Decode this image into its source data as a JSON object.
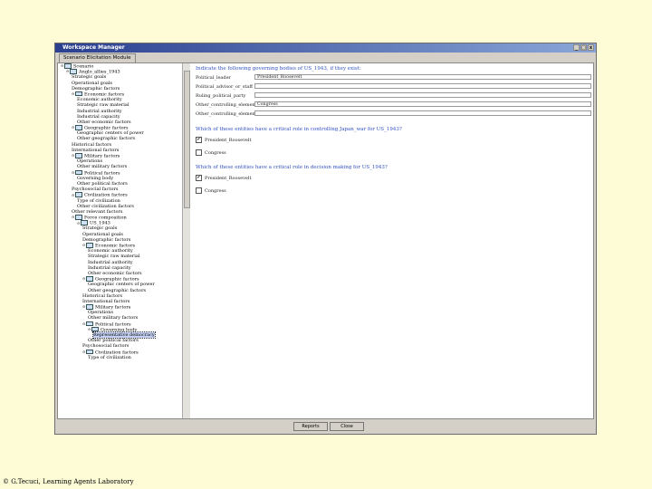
{
  "window": {
    "title": "Workspace Manager",
    "controls": [
      "_",
      "□",
      "x"
    ]
  },
  "tab": {
    "label": "Scenario Elicitation Module"
  },
  "tree": [
    {
      "d": 0,
      "exp": "⊖",
      "icon": true,
      "label": "Scenario"
    },
    {
      "d": 1,
      "exp": "⊖",
      "icon": true,
      "label": "Anglo_allies_1943"
    },
    {
      "d": 2,
      "icon": false,
      "label": "Strategic goals"
    },
    {
      "d": 2,
      "icon": false,
      "label": "Operational goals"
    },
    {
      "d": 2,
      "icon": false,
      "label": "Demographic factors"
    },
    {
      "d": 2,
      "exp": "⊖",
      "icon": true,
      "label": "Economic factors"
    },
    {
      "d": 3,
      "icon": false,
      "label": "Economic authority"
    },
    {
      "d": 3,
      "icon": false,
      "label": "Strategic raw material"
    },
    {
      "d": 3,
      "icon": false,
      "label": "Industrial authority"
    },
    {
      "d": 3,
      "icon": false,
      "label": "Industrial capacity"
    },
    {
      "d": 3,
      "icon": false,
      "label": "Other economic factors"
    },
    {
      "d": 2,
      "exp": "⊖",
      "icon": true,
      "label": "Geographic factors"
    },
    {
      "d": 3,
      "icon": false,
      "label": "Geographic centers of power"
    },
    {
      "d": 3,
      "icon": false,
      "label": "Other geographic factors"
    },
    {
      "d": 2,
      "icon": false,
      "label": "Historical factors"
    },
    {
      "d": 2,
      "icon": false,
      "label": "International factors"
    },
    {
      "d": 2,
      "exp": "⊖",
      "icon": true,
      "label": "Military factors"
    },
    {
      "d": 3,
      "icon": false,
      "label": "Operations"
    },
    {
      "d": 3,
      "icon": false,
      "label": "Other military factors"
    },
    {
      "d": 2,
      "exp": "⊖",
      "icon": true,
      "label": "Political factors"
    },
    {
      "d": 3,
      "icon": false,
      "label": "Governing body"
    },
    {
      "d": 3,
      "icon": false,
      "label": "Other political factors"
    },
    {
      "d": 2,
      "icon": false,
      "label": "Psychosocial factors"
    },
    {
      "d": 2,
      "exp": "⊖",
      "icon": true,
      "label": "Civilization factors"
    },
    {
      "d": 3,
      "icon": false,
      "label": "Type of civilization"
    },
    {
      "d": 3,
      "icon": false,
      "label": "Other civilization factors"
    },
    {
      "d": 2,
      "icon": false,
      "label": "Other relevant factors"
    },
    {
      "d": 2,
      "exp": "⊖",
      "icon": true,
      "label": "Force composition"
    },
    {
      "d": 3,
      "exp": "⊖",
      "icon": true,
      "label": "US_1943"
    },
    {
      "d": 4,
      "icon": false,
      "label": "Strategic goals"
    },
    {
      "d": 4,
      "icon": false,
      "label": "Operational goals"
    },
    {
      "d": 4,
      "icon": false,
      "label": "Demographic factors"
    },
    {
      "d": 4,
      "exp": "⊖",
      "icon": true,
      "label": "Economic factors"
    },
    {
      "d": 5,
      "icon": false,
      "label": "Economic authority"
    },
    {
      "d": 5,
      "icon": false,
      "label": "Strategic raw material"
    },
    {
      "d": 5,
      "icon": false,
      "label": "Industrial authority"
    },
    {
      "d": 5,
      "icon": false,
      "label": "Industrial capacity"
    },
    {
      "d": 5,
      "icon": false,
      "label": "Other economic factors"
    },
    {
      "d": 4,
      "exp": "⊖",
      "icon": true,
      "label": "Geographic factors"
    },
    {
      "d": 5,
      "icon": false,
      "label": "Geographic centers of power"
    },
    {
      "d": 5,
      "icon": false,
      "label": "Other geographic factors"
    },
    {
      "d": 4,
      "icon": false,
      "label": "Historical factors"
    },
    {
      "d": 4,
      "icon": false,
      "label": "International factors"
    },
    {
      "d": 4,
      "exp": "⊖",
      "icon": true,
      "label": "Military factors"
    },
    {
      "d": 5,
      "icon": false,
      "label": "Operations"
    },
    {
      "d": 5,
      "icon": false,
      "label": "Other military factors"
    },
    {
      "d": 4,
      "exp": "⊖",
      "icon": true,
      "label": "Political factors"
    },
    {
      "d": 5,
      "exp": "⊖",
      "icon": true,
      "label": "Governing body"
    },
    {
      "d": 6,
      "icon": false,
      "label": "Representative democracy",
      "selected": true
    },
    {
      "d": 5,
      "icon": false,
      "label": "Other political factors"
    },
    {
      "d": 4,
      "icon": false,
      "label": "Psychosocial factors"
    },
    {
      "d": 4,
      "exp": "⊖",
      "icon": true,
      "label": "Civilization factors"
    },
    {
      "d": 5,
      "icon": false,
      "label": "Type of civilization"
    }
  ],
  "form": {
    "heading": "Indicate the following governing bodies of US_1943, if they exist:",
    "fields": [
      {
        "label": "Political_leader",
        "value": "President_Roosevelt"
      },
      {
        "label": "Political_advisor_or_staff",
        "value": ""
      },
      {
        "label": "Ruling_political_party",
        "value": ""
      },
      {
        "label": "Other_controlling_element",
        "value": "Congress"
      },
      {
        "label": "Other_controlling_element",
        "value": ""
      }
    ],
    "q1": "Which of these entities have a critical role in controlling Japan_war for US_1943?",
    "q1_options": [
      {
        "label": "President_Roosevelt",
        "checked": "✔"
      },
      {
        "label": "Congress",
        "checked": ""
      }
    ],
    "q2": "Which of these entities have a critical role in decision making for US_1943?",
    "q2_options": [
      {
        "label": "President_Roosevelt",
        "checked": "✔"
      },
      {
        "label": "Congress",
        "checked": ""
      }
    ]
  },
  "buttons": {
    "reports": "Reports",
    "close": "Close"
  },
  "footer": "© G.Tecuci, Learning Agents Laboratory"
}
